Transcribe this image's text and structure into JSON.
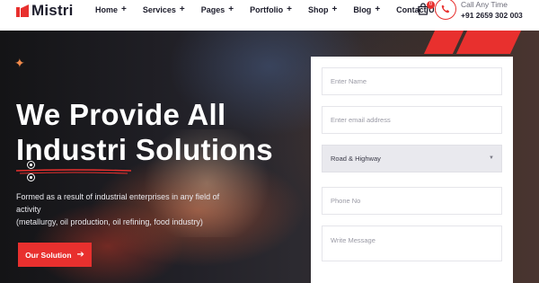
{
  "brand": {
    "name": "Mistri",
    "accent": "#e8302e"
  },
  "nav": {
    "items": [
      {
        "label": "Home",
        "has_submenu": true
      },
      {
        "label": "Services",
        "has_submenu": true
      },
      {
        "label": "Pages",
        "has_submenu": true
      },
      {
        "label": "Portfolio",
        "has_submenu": true
      },
      {
        "label": "Shop",
        "has_submenu": true
      },
      {
        "label": "Blog",
        "has_submenu": true
      },
      {
        "label": "Contact Us",
        "has_submenu": false
      }
    ],
    "submenu_symbol": "+"
  },
  "cart": {
    "icon": "shopping-bag-icon",
    "count": "0"
  },
  "contact": {
    "icon": "phone-icon",
    "label": "Call Any Time",
    "number": "+91 2659 302 003"
  },
  "hero": {
    "title_line1": "We Provide All",
    "title_line2": "Industri Solutions",
    "description_line1": "Formed as a result of industrial enterprises in any field of activity",
    "description_line2": "(metallurgy, oil production, oil refining, food industry)",
    "cta_label": "Our Solution",
    "cta_icon": "arrow-right-icon",
    "slide_dots": 2,
    "active_dot": 1
  },
  "form": {
    "name_placeholder": "Enter Name",
    "email_placeholder": "Enter email address",
    "service_selected": "Road & Highway",
    "phone_placeholder": "Phone No",
    "message_placeholder": "Write Message"
  }
}
